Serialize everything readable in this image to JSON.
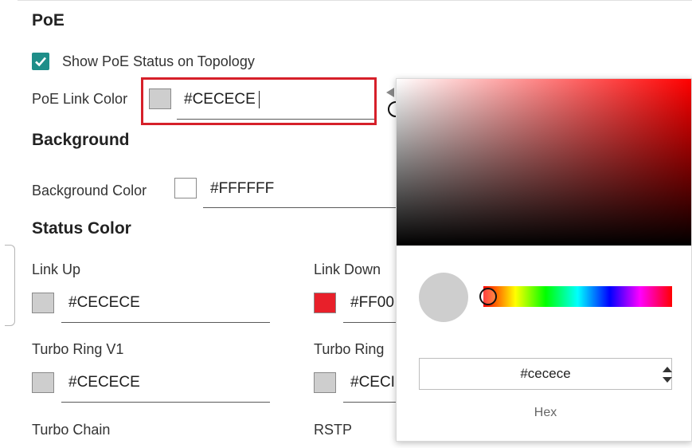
{
  "poe": {
    "heading": "PoE",
    "show_status_label": "Show PoE Status on Topology",
    "show_status_checked": true,
    "link_color_label": "PoE Link Color",
    "link_color_value": "#CECECE",
    "link_color_swatch": "#cecece"
  },
  "background": {
    "heading": "Background",
    "color_label": "Background Color",
    "color_value": "#FFFFFF",
    "color_swatch": "#ffffff"
  },
  "status_color": {
    "heading": "Status Color",
    "link_up_label": "Link Up",
    "link_up_value": "#CECECE",
    "link_down_label": "Link Down",
    "link_down_value": "#FF00",
    "turbo_ring_v1_label": "Turbo Ring V1",
    "turbo_ring_v1_value": "#CECECE",
    "turbo_ring_label": "Turbo Ring",
    "turbo_ring_value": "#CECI",
    "turbo_chain_label": "Turbo Chain",
    "rstp_label": "RSTP"
  },
  "colors": {
    "accent": "#1e8e89",
    "highlight": "#d6202a",
    "link_down": "#e8202a",
    "gray": "#cecece"
  },
  "picker": {
    "hex_value": "#cecece",
    "mode_label": "Hex",
    "current_color": "#cecece"
  }
}
